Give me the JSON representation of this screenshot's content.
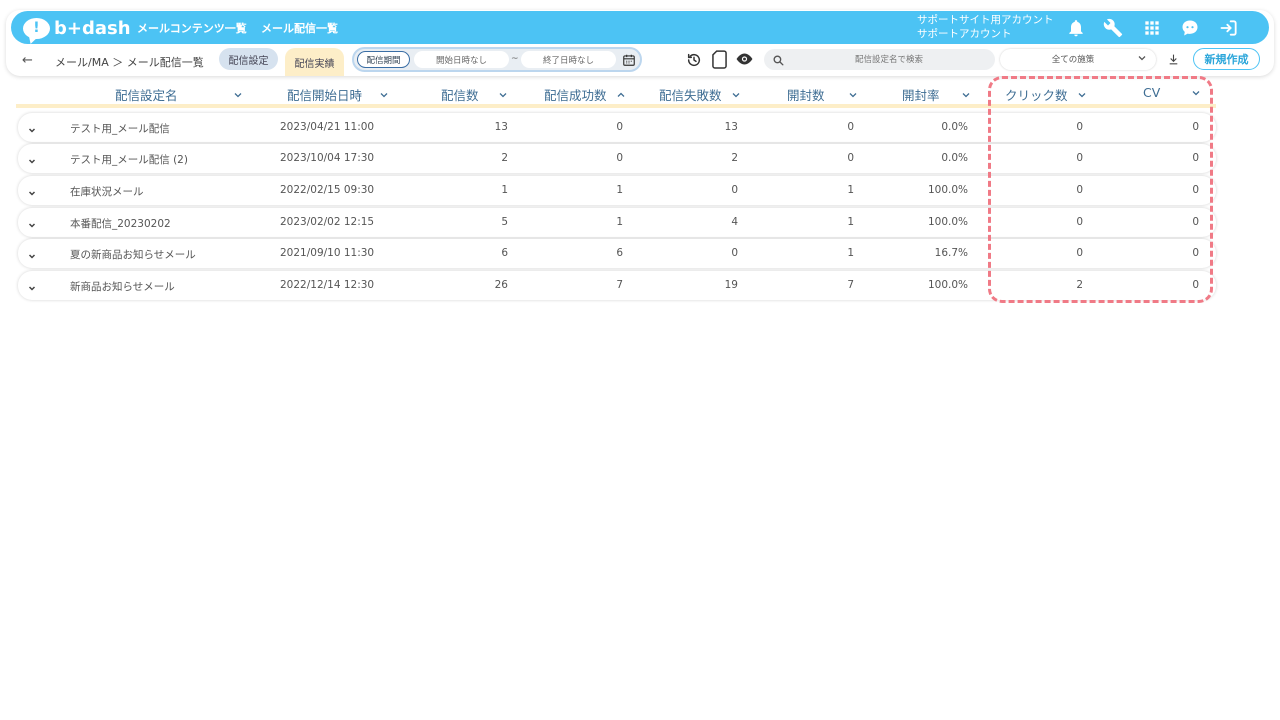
{
  "header": {
    "logo_text": "b+dash",
    "logo_mark": "!",
    "nav": [
      "メールコンテンツ一覧",
      "メール配信一覧"
    ],
    "account_line1": "サポートサイト用アカウント",
    "account_line2": "サポートアカウント",
    "icons": [
      "bell-icon",
      "wrench-icon",
      "grid-icon",
      "chat-icon",
      "logout-icon"
    ],
    "accent": "#4cc3f4"
  },
  "toolbar": {
    "back_glyph": "←",
    "breadcrumb": "メール/MA ＞ メール配信一覧",
    "tab_settings": "配信設定",
    "tab_results": "配信実績",
    "range_label": "配信期間",
    "start_placeholder": "開始日時なし",
    "tilde": "~",
    "end_placeholder": "終了日時なし",
    "search_placeholder": "配信設定名で検索",
    "filter_selected": "全ての施策",
    "new_button": "新規作成"
  },
  "table": {
    "columns": [
      "配信設定名",
      "配信開始日時",
      "配信数",
      "配信成功数",
      "配信失敗数",
      "開封数",
      "開封率",
      "クリック数",
      "CV"
    ],
    "sort_column": "配信成功数",
    "rows": [
      [
        "テスト用_メール配信",
        "2023/04/21 11:00",
        "13",
        "0",
        "13",
        "0",
        "0.0%",
        "0",
        "0"
      ],
      [
        "テスト用_メール配信 (2)",
        "2023/10/04 17:30",
        "2",
        "0",
        "2",
        "0",
        "0.0%",
        "0",
        "0"
      ],
      [
        "在庫状況メール",
        "2022/02/15 09:30",
        "1",
        "1",
        "0",
        "1",
        "100.0%",
        "0",
        "0"
      ],
      [
        "本番配信_20230202",
        "2023/02/02 12:15",
        "5",
        "1",
        "4",
        "1",
        "100.0%",
        "0",
        "0"
      ],
      [
        "夏の新商品お知らせメール",
        "2021/09/10 11:30",
        "6",
        "6",
        "0",
        "1",
        "16.7%",
        "0",
        "0"
      ],
      [
        "新商品お知らせメール",
        "2022/12/14 12:30",
        "26",
        "7",
        "19",
        "7",
        "100.0%",
        "2",
        "0"
      ]
    ]
  },
  "highlight_color": "#f07a86"
}
